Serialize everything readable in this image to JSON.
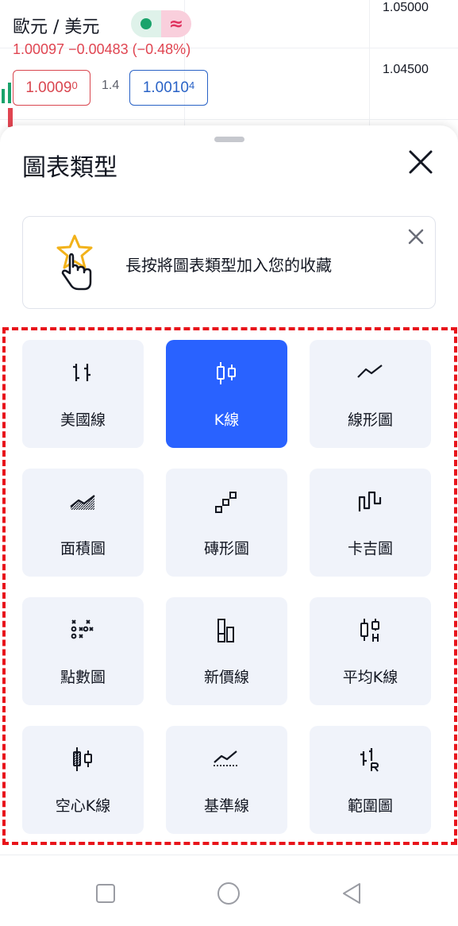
{
  "chart": {
    "symbol": "歐元 / 美元",
    "quote": "1.00097  −0.00483 (−0.48%)",
    "price_labels": [
      "1.05000",
      "1.04500"
    ],
    "bid_main": "1.0009",
    "bid_sup": "0",
    "spread": "1.4",
    "ask_main": "1.0010",
    "ask_sup": "4",
    "status_right_symbol": "≈",
    "colors": {
      "down": "#e04551",
      "up": "#1aa36b",
      "ask": "#2962c6"
    }
  },
  "sheet": {
    "title": "圖表類型",
    "tip": "長按將圖表類型加入您的收藏",
    "chart_types": [
      {
        "label": "美國線",
        "icon": "bars-icon"
      },
      {
        "label": "K線",
        "icon": "candles-icon",
        "selected": true
      },
      {
        "label": "線形圖",
        "icon": "line-icon"
      },
      {
        "label": "面積圖",
        "icon": "area-icon"
      },
      {
        "label": "磚形圖",
        "icon": "renko-icon"
      },
      {
        "label": "卡吉圖",
        "icon": "kagi-icon"
      },
      {
        "label": "點數圖",
        "icon": "point-figure-icon"
      },
      {
        "label": "新價線",
        "icon": "line-break-icon"
      },
      {
        "label": "平均K線",
        "icon": "heikin-ashi-icon"
      },
      {
        "label": "空心K線",
        "icon": "hollow-candles-icon"
      },
      {
        "label": "基準線",
        "icon": "baseline-icon"
      },
      {
        "label": "範圍圖",
        "icon": "range-icon"
      }
    ],
    "accent_color": "#2962ff",
    "highlight_border_color": "#e8141b"
  },
  "navbar": {
    "buttons": [
      "recents-icon",
      "home-icon",
      "back-icon"
    ]
  }
}
